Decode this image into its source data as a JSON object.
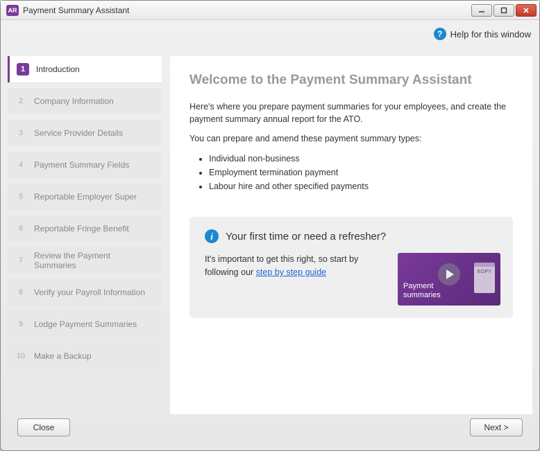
{
  "window": {
    "app_badge": "AR",
    "title": "Payment Summary Assistant"
  },
  "help": {
    "label": "Help for this window"
  },
  "sidebar": {
    "steps": [
      {
        "num": "1",
        "label": "Introduction",
        "active": true
      },
      {
        "num": "2",
        "label": "Company Information"
      },
      {
        "num": "3",
        "label": "Service Provider Details"
      },
      {
        "num": "4",
        "label": "Payment Summary Fields"
      },
      {
        "num": "5",
        "label": "Reportable Employer Super"
      },
      {
        "num": "6",
        "label": "Reportable Fringe Benefit"
      },
      {
        "num": "7",
        "label": "Review the Payment Summaries"
      },
      {
        "num": "8",
        "label": "Verify your Payroll Information"
      },
      {
        "num": "9",
        "label": "Lodge Payment Summaries"
      },
      {
        "num": "10",
        "label": "Make a Backup"
      }
    ]
  },
  "main": {
    "heading": "Welcome to the Payment Summary Assistant",
    "intro1": "Here's where you prepare payment summaries for your employees, and create the payment summary annual report for the ATO.",
    "intro2": "You can prepare and amend these payment summary types:",
    "bullets": [
      "Individual non-business",
      "Employment termination payment",
      "Labour hire and other specified payments"
    ],
    "callout": {
      "title": "Your first time or need a refresher?",
      "text_before_link": "It's important to get this right, so start by following our ",
      "link_text": "step by step guide",
      "video_caption_line1": "Payment",
      "video_caption_line2": "summaries",
      "calendar_text": "EOPY"
    }
  },
  "footer": {
    "close": "Close",
    "next": "Next >"
  }
}
